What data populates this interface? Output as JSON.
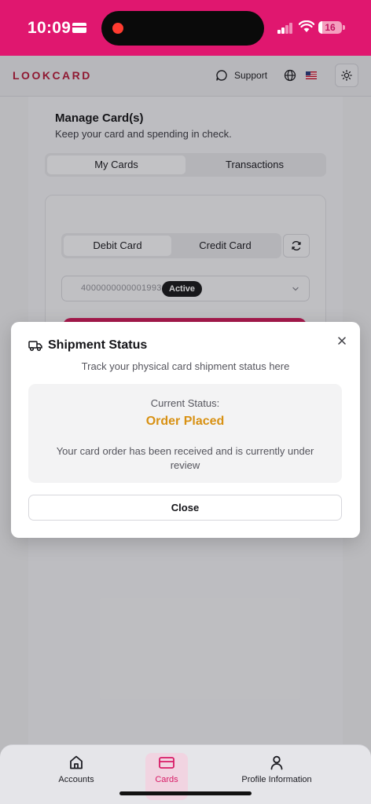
{
  "status_bar": {
    "time": "10:09",
    "battery": "16",
    "battery_level": 0.16
  },
  "header": {
    "logo": "LOOKCARD",
    "support_label": "Support"
  },
  "page": {
    "title": "Manage Card(s)",
    "subtitle": "Keep your card and spending in check.",
    "tabs": [
      {
        "label": "My Cards"
      },
      {
        "label": "Transactions"
      }
    ],
    "card_types": [
      {
        "label": "Debit Card"
      },
      {
        "label": "Credit Card"
      }
    ],
    "card_number": "4000000000001993",
    "card_status": "Active"
  },
  "modal": {
    "title": "Shipment Status",
    "description": "Track your physical card shipment status here",
    "status_label": "Current Status:",
    "status_value": "Order Placed",
    "status_message": "Your card order has been received and is currently under review",
    "close_label": "Close"
  },
  "nav": [
    {
      "label": "Accounts",
      "icon": "home-icon"
    },
    {
      "label": "Cards",
      "icon": "card-icon"
    },
    {
      "label": "Profile Information",
      "icon": "user-icon"
    }
  ],
  "colors": {
    "brand": "#e0176f",
    "status": "#d89113"
  }
}
